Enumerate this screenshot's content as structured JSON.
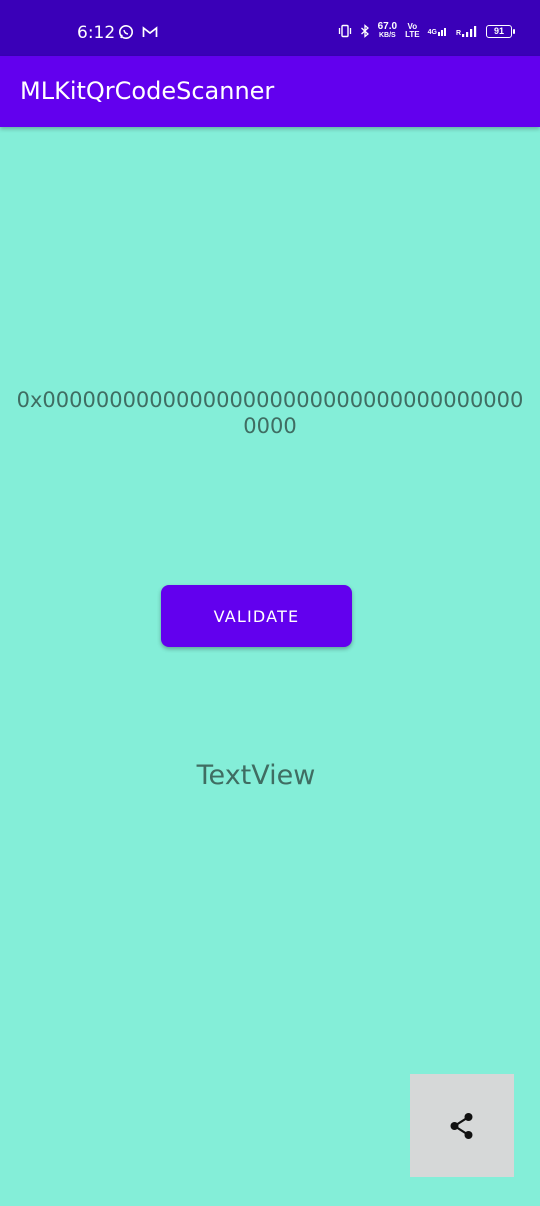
{
  "status_bar": {
    "time": "6:12",
    "net_speed_value": "67.0",
    "net_speed_unit": "KB/S",
    "volte_top": "Vo",
    "volte_bottom": "LTE",
    "network_type": "4G",
    "roaming": "R",
    "battery": "91"
  },
  "app_bar": {
    "title": "MLKitQrCodeScanner"
  },
  "main": {
    "address_text": "0x0000000000000000000000000000000000000000",
    "validate_label": "VALIDATE",
    "result_text": "TextView"
  },
  "colors": {
    "background": "#84eed8",
    "status_bar": "#3a00b8",
    "app_bar": "#6200ee",
    "button": "#6200ee",
    "text": "#3f6d62",
    "share_bg": "#d6d8d8"
  },
  "icons": {
    "share": "share-icon",
    "whatsapp": "whatsapp-icon",
    "gmail": "gmail-icon",
    "vibrate": "vibrate-icon",
    "bluetooth": "bluetooth-icon",
    "signal": "signal-icon"
  }
}
